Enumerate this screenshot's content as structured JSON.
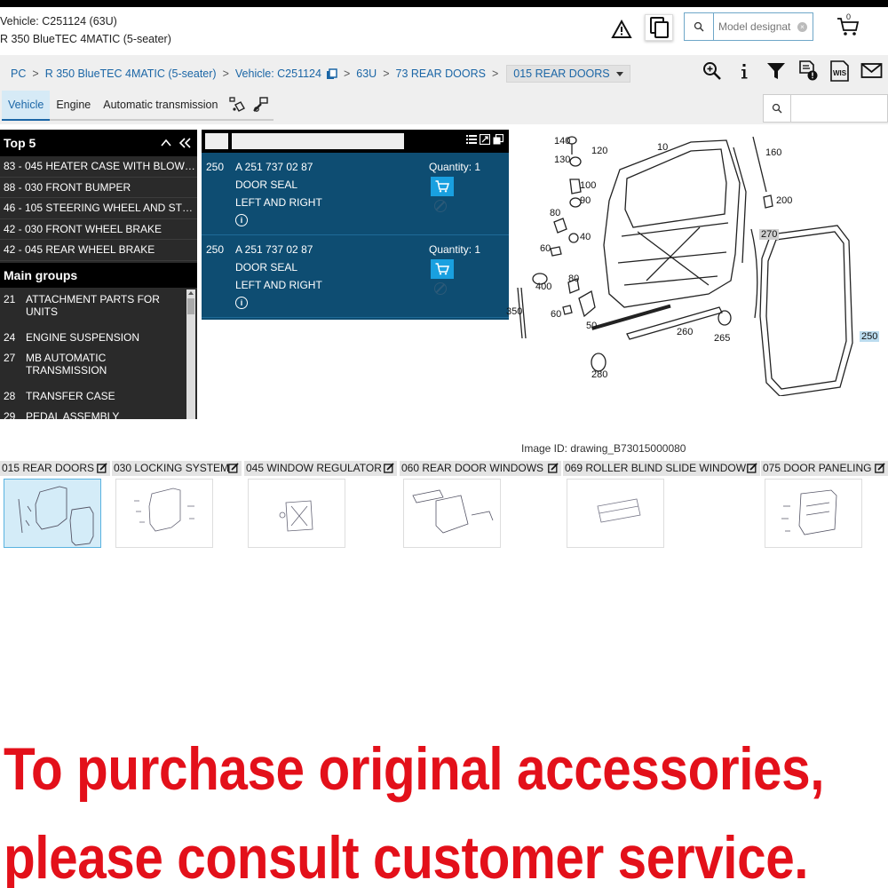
{
  "header": {
    "vehicle_line": "Vehicle: C251124 (63U)",
    "model_line": "R 350 BlueTEC 4MATIC (5-seater)",
    "search_placeholder": "Model designat",
    "clear": "×",
    "cart_count": "0"
  },
  "breadcrumb": {
    "items": [
      "PC",
      "R 350 BlueTEC 4MATIC (5-seater)",
      "Vehicle: C251124",
      "63U",
      "73 REAR DOORS"
    ],
    "separator": ">",
    "current": "015 REAR DOORS"
  },
  "toolbar_icons": [
    "zoom-in-icon",
    "info-icon",
    "filter-icon",
    "document-warning-icon",
    "wis-icon",
    "mail-icon"
  ],
  "wis_label": "WIS",
  "tabs": {
    "items": [
      "Vehicle",
      "Engine",
      "Automatic transmission"
    ],
    "active": "Vehicle"
  },
  "top5": {
    "title": "Top 5",
    "items": [
      "83 - 045 HEATER CASE WITH BLOWER",
      "88 - 030 FRONT BUMPER",
      "46 - 105 STEERING WHEEL AND STEE...",
      "42 - 030 FRONT WHEEL BRAKE",
      "42 - 045 REAR WHEEL BRAKE"
    ]
  },
  "main_groups": {
    "title": "Main groups",
    "items": [
      {
        "no": "21",
        "name": "ATTACHMENT PARTS FOR UNITS"
      },
      {
        "no": "24",
        "name": "ENGINE SUSPENSION"
      },
      {
        "no": "27",
        "name": "MB AUTOMATIC TRANSMISSION"
      },
      {
        "no": "28",
        "name": "TRANSFER CASE"
      },
      {
        "no": "29",
        "name": "PEDAL ASSEMBLY"
      }
    ]
  },
  "parts": [
    {
      "pos": "250",
      "number": "A 251 737 02 87",
      "desc": "DOOR SEAL",
      "desc2": "LEFT AND RIGHT",
      "qty": "Quantity: 1",
      "info": "i"
    },
    {
      "pos": "250",
      "number": "A 251 737 02 87",
      "desc": "DOOR SEAL",
      "desc2": "LEFT AND RIGHT",
      "qty": "Quantity: 1",
      "info": "i"
    }
  ],
  "drawing": {
    "callouts": [
      "140",
      "130",
      "120",
      "10",
      "160",
      "100",
      "90",
      "200",
      "80",
      "40",
      "270",
      "60",
      "400",
      "80",
      "350",
      "60",
      "50",
      "260",
      "265",
      "250",
      "280"
    ],
    "image_id": "Image ID: drawing_B73015000080"
  },
  "thumbnails": [
    {
      "label": "015 REAR DOORS",
      "selected": true
    },
    {
      "label": "030 LOCKING SYSTEM",
      "selected": false
    },
    {
      "label": "045 WINDOW REGULATOR",
      "selected": false
    },
    {
      "label": "060 REAR DOOR WINDOWS",
      "selected": false
    },
    {
      "label": "069 ROLLER BLIND SLIDE WINDOW",
      "selected": false
    },
    {
      "label": "075 DOOR PANELING",
      "selected": false
    }
  ],
  "promo": {
    "line1": "To purchase original accessories,",
    "line2": "please consult customer service."
  },
  "colors": {
    "accent": "#1b66a6",
    "part_panel": "#0e4d72",
    "cart_button": "#19a0e0",
    "promo_red": "#e3101a"
  }
}
